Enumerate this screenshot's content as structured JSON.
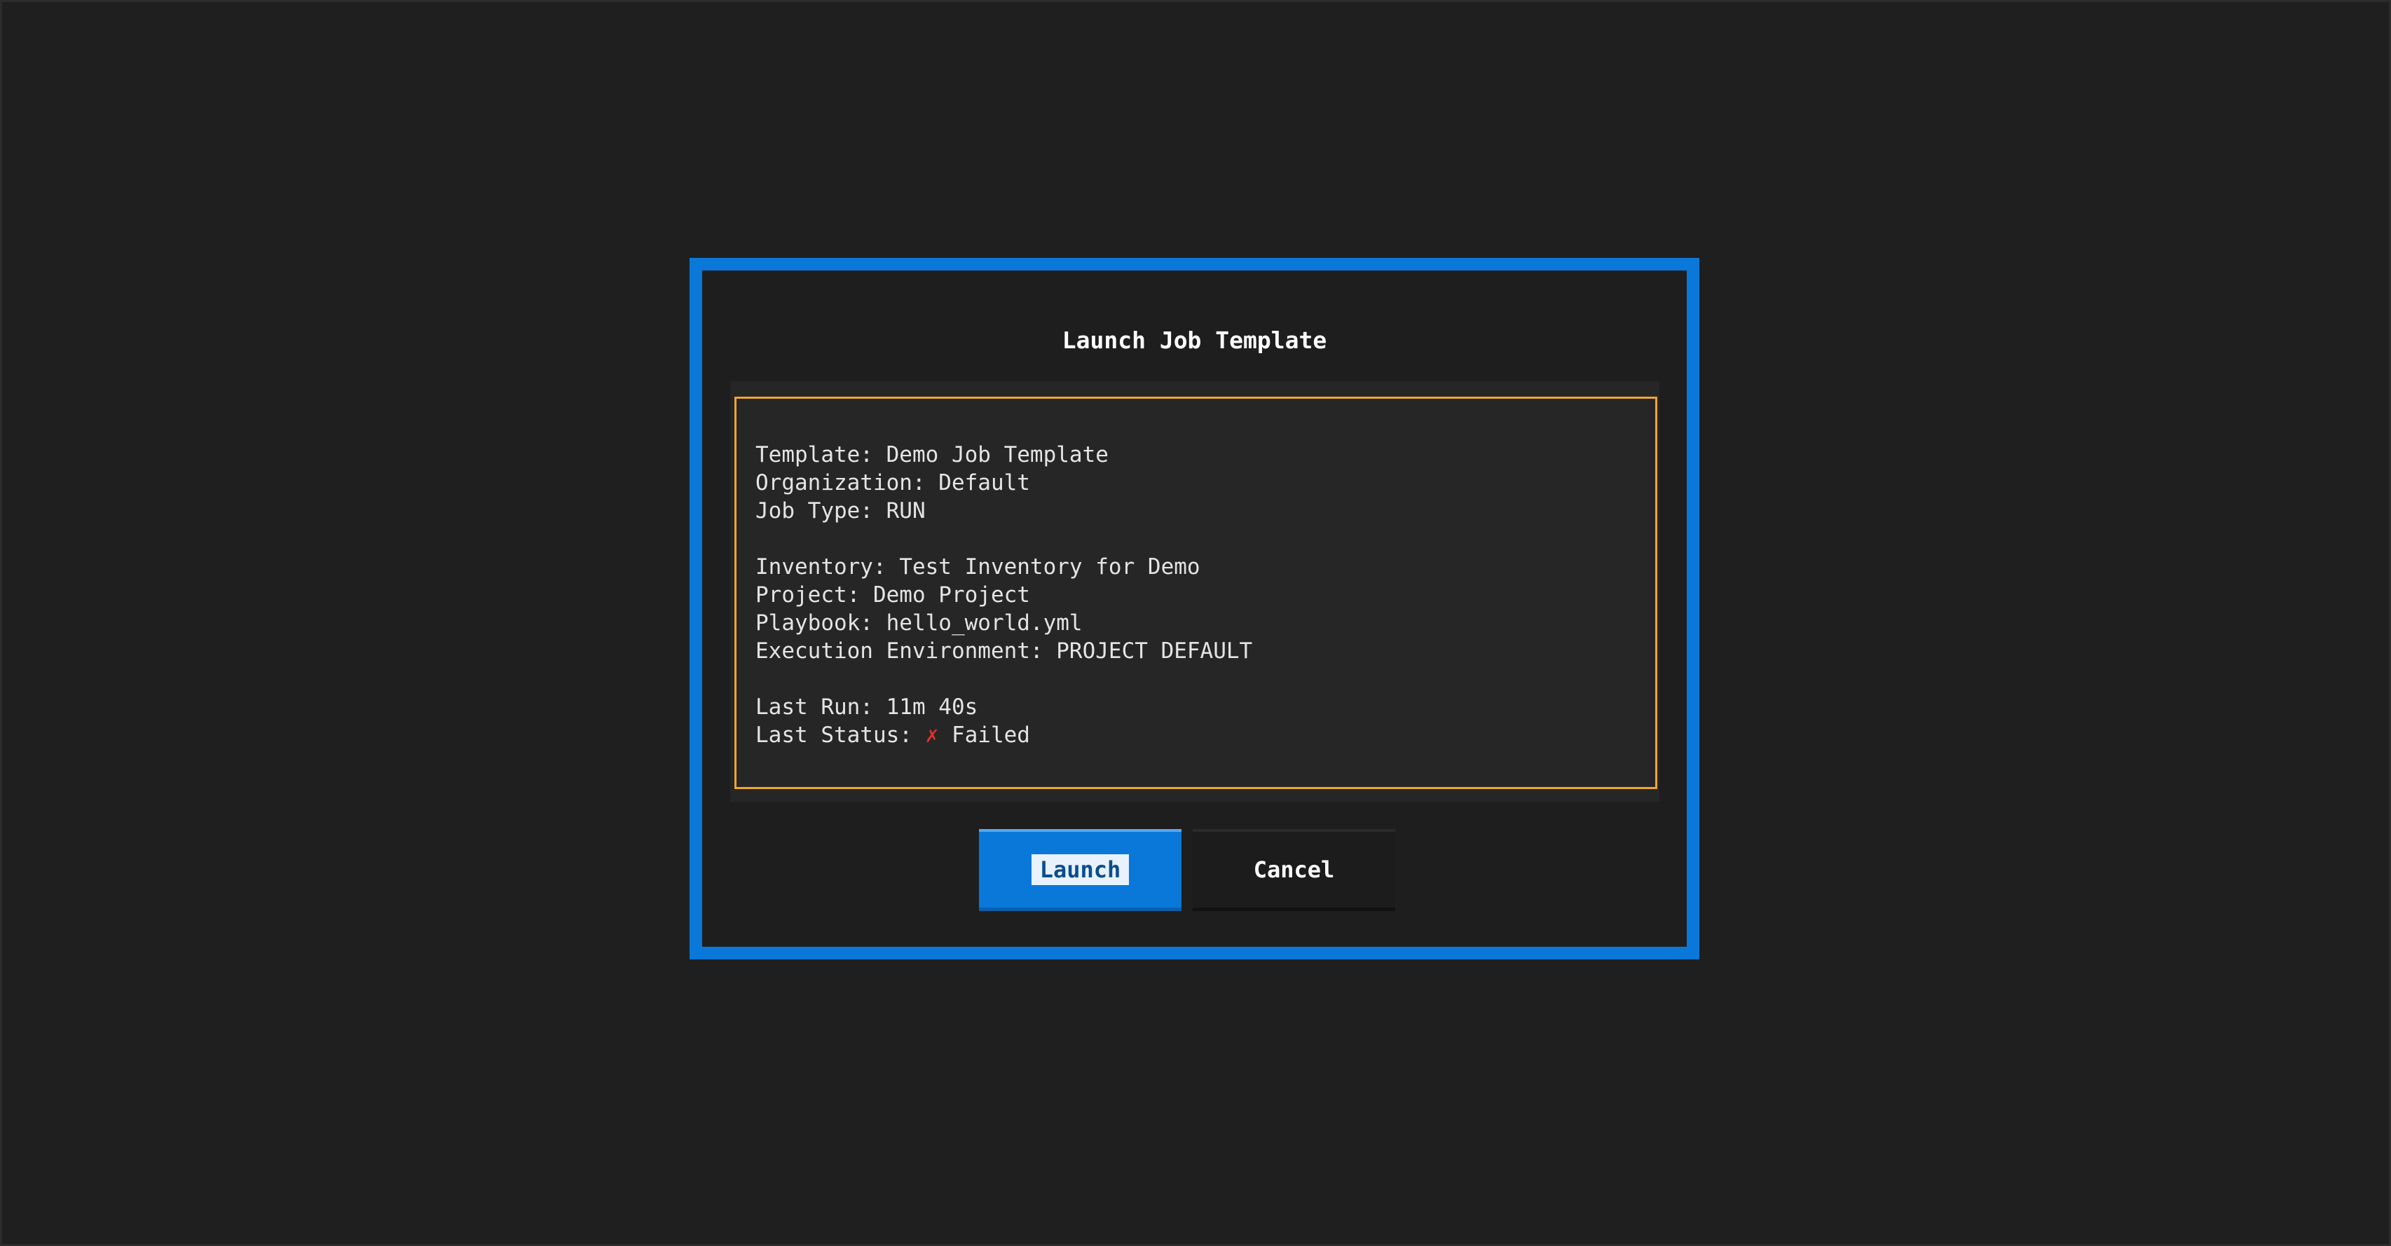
{
  "dialog": {
    "title": "Launch Job Template"
  },
  "info": {
    "template": "Template: Demo Job Template",
    "organization": "Organization: Default",
    "job_type": "Job Type: RUN",
    "inventory": "Inventory: Test Inventory for Demo",
    "project": "Project: Demo Project",
    "playbook": "Playbook: hello_world.yml",
    "execution_environment": "Execution Environment: PROJECT DEFAULT",
    "last_run": "Last Run: 11m 40s",
    "last_status_label": "Last Status: ",
    "last_status_icon": "✗",
    "last_status_value": " Failed"
  },
  "buttons": {
    "launch": "Launch",
    "cancel": "Cancel"
  },
  "colors": {
    "accent": "#0a78d8",
    "panel_border": "#f0a530",
    "error": "#e0302a"
  }
}
